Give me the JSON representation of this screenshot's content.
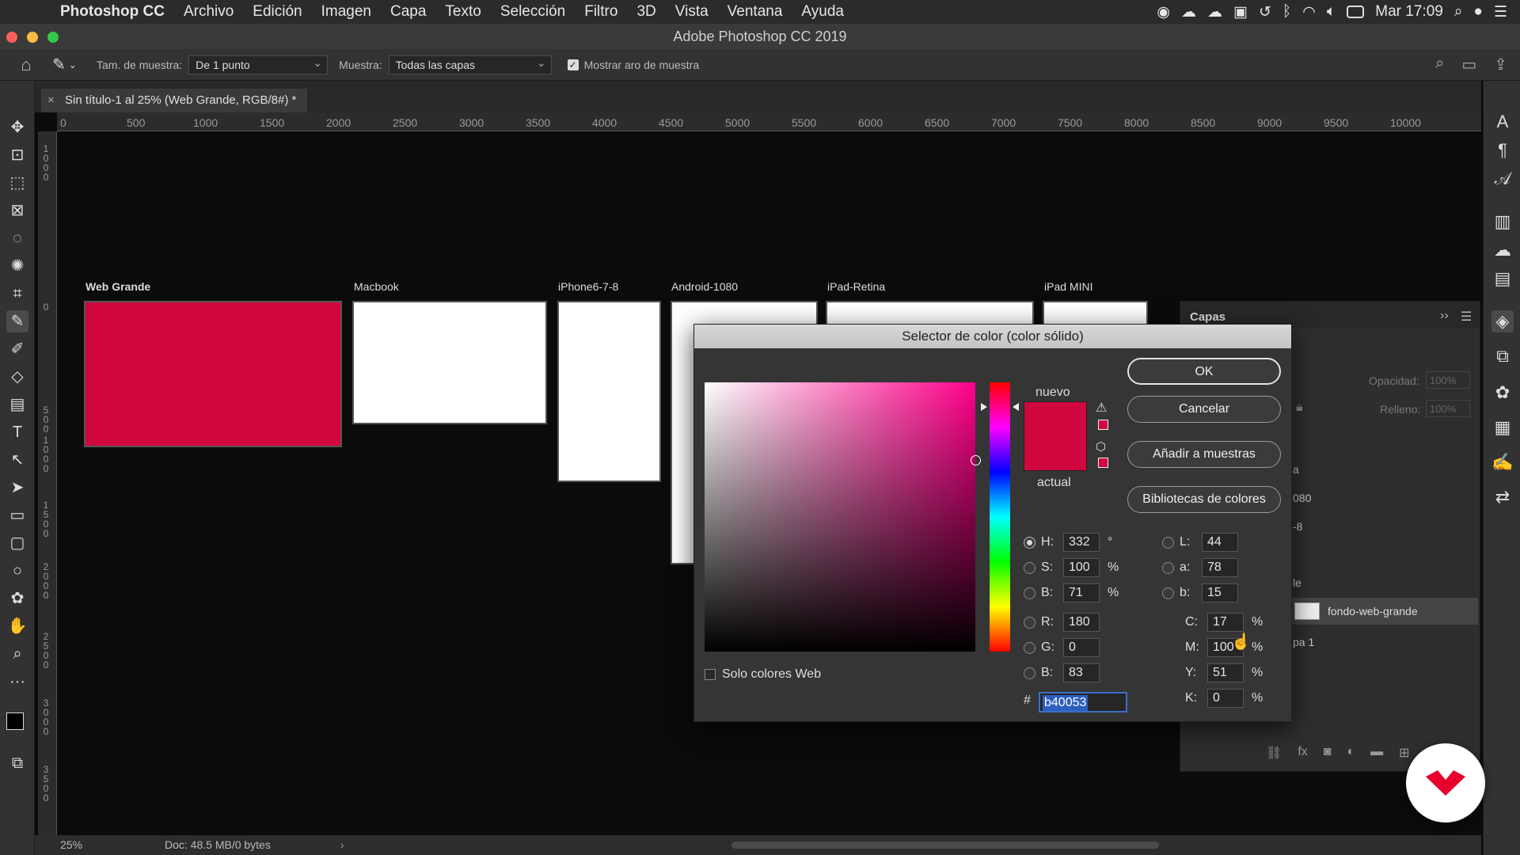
{
  "menubar": {
    "app_name": "Photoshop CC",
    "items": [
      "Archivo",
      "Edición",
      "Imagen",
      "Capa",
      "Texto",
      "Selección",
      "Filtro",
      "3D",
      "Vista",
      "Ventana",
      "Ayuda"
    ],
    "clock": "Mar 17:09"
  },
  "window": {
    "title": "Adobe Photoshop CC 2019"
  },
  "options": {
    "sample_size_label": "Tam. de muestra:",
    "sample_size_value": "De 1 punto",
    "sample_label": "Muestra:",
    "sample_value": "Todas las capas",
    "show_ring_label": "Mostrar aro de muestra",
    "show_ring_checked": true
  },
  "document": {
    "tab_title": "Sin título-1 al 25% (Web Grande, RGB/8#) *"
  },
  "ruler": {
    "h_ticks": [
      "0",
      "500",
      "1000",
      "1500",
      "2000",
      "2500",
      "3000",
      "3500",
      "4000",
      "4500",
      "5000",
      "5500",
      "6000",
      "6500",
      "7000",
      "7500",
      "8000",
      "8500",
      "9000",
      "9500",
      "10000"
    ],
    "v_ticks": [
      "1\n0\n0\n0",
      "0",
      "5\n0\n0",
      "1\n0\n0\n0",
      "1\n5\n0\n0",
      "2\n0\n0\n0",
      "2\n5\n0\n0",
      "3\n0\n0\n0",
      "3\n5\n0\n0"
    ]
  },
  "artboards": [
    {
      "label": "Web Grande",
      "fill": "#d0073e"
    },
    {
      "label": "Macbook",
      "fill": "#ffffff"
    },
    {
      "label": "iPhone6-7-8",
      "fill": "#ffffff"
    },
    {
      "label": "Android-1080",
      "fill": "#ffffff"
    },
    {
      "label": "iPad-Retina",
      "fill": "#ffffff"
    },
    {
      "label": "iPad MINI",
      "fill": "#ffffff"
    }
  ],
  "layers_panel": {
    "title": "Capas",
    "opacity_label": "Opacidad:",
    "opacity_value": "100%",
    "fill_label": "Relleno:",
    "fill_value": "100%",
    "partial_items": [
      "a",
      "080",
      "-8",
      "le"
    ],
    "selected_layer": "fondo-web-grande",
    "last_item": "pa 1"
  },
  "status": {
    "zoom": "25%",
    "doc": "Doc: 48.5 MB/0 bytes"
  },
  "dialog": {
    "title": "Selector de color (color sólido)",
    "buttons": {
      "ok": "OK",
      "cancel": "Cancelar",
      "add": "Añadir a muestras",
      "libraries": "Bibliotecas de colores"
    },
    "new_label": "nuevo",
    "current_label": "actual",
    "new_color": "#d0073e",
    "current_color": "#d0073e",
    "web_only_label": "Solo colores Web",
    "hsb": [
      {
        "label": "H:",
        "value": "332",
        "unit": "°",
        "selected": true
      },
      {
        "label": "S:",
        "value": "100",
        "unit": "%"
      },
      {
        "label": "B:",
        "value": "71",
        "unit": "%"
      }
    ],
    "rgb": [
      {
        "label": "R:",
        "value": "180"
      },
      {
        "label": "G:",
        "value": "0"
      },
      {
        "label": "B:",
        "value": "83"
      }
    ],
    "lab": [
      {
        "label": "L:",
        "value": "44"
      },
      {
        "label": "a:",
        "value": "78"
      },
      {
        "label": "b:",
        "value": "15"
      }
    ],
    "cmyk": [
      {
        "label": "C:",
        "value": "17",
        "unit": "%"
      },
      {
        "label": "M:",
        "value": "100",
        "unit": "%"
      },
      {
        "label": "Y:",
        "value": "51",
        "unit": "%"
      },
      {
        "label": "K:",
        "value": "0",
        "unit": "%"
      }
    ],
    "hex_label": "#",
    "hex_value": "b40053",
    "field_base_color": "#ff008a"
  },
  "colors": {
    "accent_red": "#d0073e",
    "brand_red": "#e8002d"
  }
}
